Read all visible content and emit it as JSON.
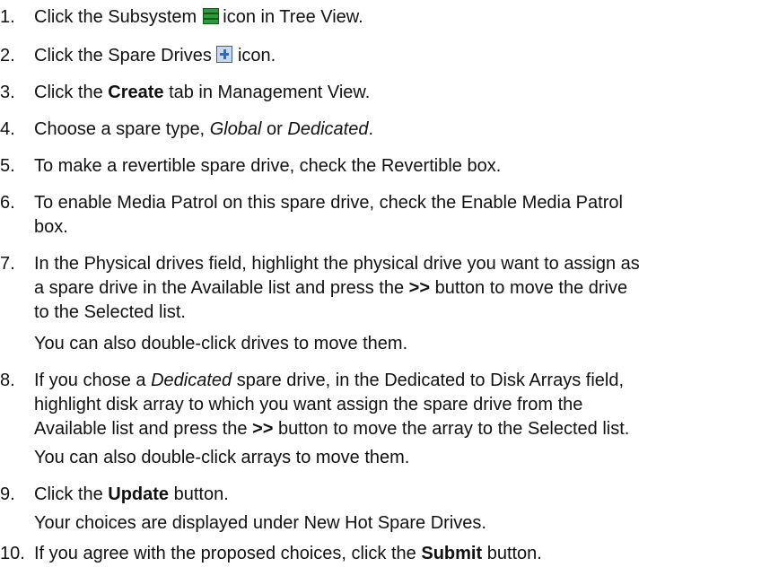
{
  "steps": [
    {
      "n": "1.",
      "a": "Click the Subsystem",
      "icon": "subsystem-icon",
      "b": "icon in Tree View."
    },
    {
      "n": "2.",
      "a": "Click the Spare Drives",
      "icon": "spare-drives-icon",
      "b": "icon."
    },
    {
      "n": "3.",
      "a": "Click the ",
      "bold": "Create",
      "b": " tab in Management View."
    },
    {
      "n": "4.",
      "a": "Choose a spare type, ",
      "it1": "Global",
      "mid": " or ",
      "it2": "Dedicated",
      "b": "."
    },
    {
      "n": "5.",
      "a": "To make a revertible spare drive, check the Revertible box."
    },
    {
      "n": "6.",
      "a1": "To enable Media Patrol on this spare drive, check the Enable Media Patrol",
      "a2": "box."
    },
    {
      "n": "7.",
      "l1": "In the Physical drives field, highlight the physical drive you want to assign as",
      "l2a": "a spare drive in the Available list and press the ",
      "l2b": ">>",
      "l2c": " button to move the drive",
      "l3": "to the Selected list.",
      "note": "You can also double-click drives to move them."
    },
    {
      "n": "8.",
      "l1a": "If you chose a ",
      "l1b": "Dedicated",
      "l1c": " spare drive, in the Dedicated to Disk Arrays field,",
      "l2": "highlight disk array to which you want assign the spare drive from the",
      "l3a": "Available list and press the ",
      "l3b": ">>",
      "l3c": " button to move the array to the Selected list.",
      "note": "You can also double-click arrays to move them."
    },
    {
      "n": "9.",
      "a": "Click the ",
      "bold": "Update",
      "b": " button.",
      "note": "Your choices are displayed under New Hot Spare Drives."
    },
    {
      "n": "10.",
      "a": "If you agree with the proposed choices, click the ",
      "bold": "Submit",
      "b": " button."
    }
  ]
}
